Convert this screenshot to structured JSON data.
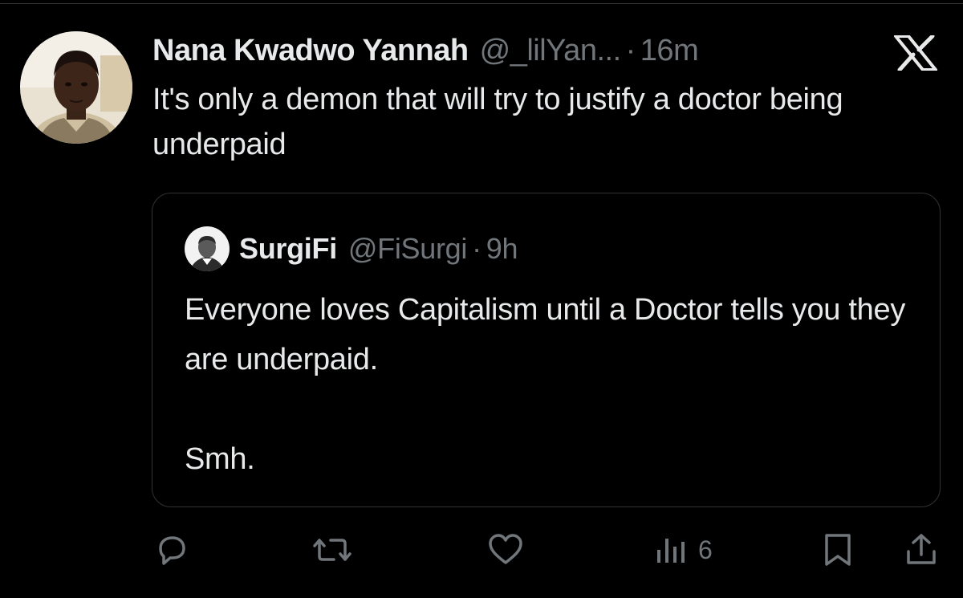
{
  "tweet": {
    "author_name": "Nana Kwadwo Yannah",
    "handle": "@_lilYan...",
    "separator": "·",
    "time": "16m",
    "text": "It's only a demon that will try to justify a doctor being underpaid"
  },
  "quote": {
    "author_name": "SurgiFi",
    "handle": "@FiSurgi",
    "separator": "·",
    "time": "9h",
    "text": "Everyone loves Capitalism until a Doctor tells you they are underpaid.\n\nSmh."
  },
  "actions": {
    "reply_icon": "reply-icon",
    "retweet_icon": "retweet-icon",
    "like_icon": "heart-icon",
    "views_icon": "analytics-icon",
    "views_count": "6",
    "bookmark_icon": "bookmark-icon",
    "share_icon": "share-icon"
  },
  "colors": {
    "background": "#000000",
    "primary_text": "#e7e9ea",
    "secondary_text": "#71767b",
    "border": "#2f3336"
  }
}
